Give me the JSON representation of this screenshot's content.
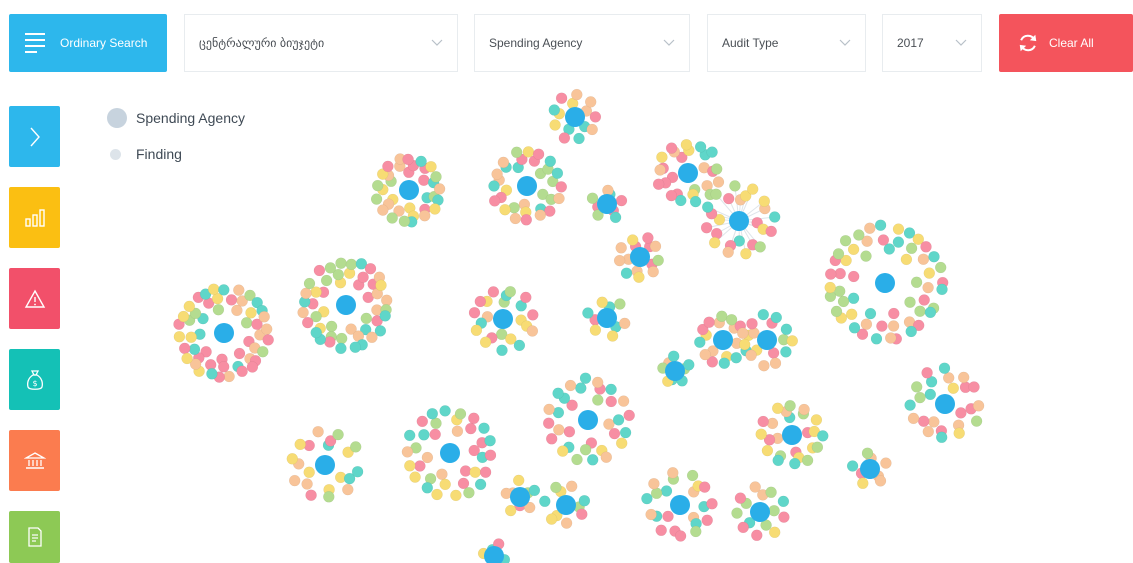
{
  "toolbar": {
    "search_label": "Ordinary Search",
    "filters": [
      {
        "name": "organization-select",
        "value": "ცენტრალური ბიუჯეტი"
      },
      {
        "name": "spending-agency-select",
        "value": "Spending Agency"
      },
      {
        "name": "audit-type-select",
        "value": "Audit Type"
      },
      {
        "name": "year-select",
        "value": "2017"
      }
    ],
    "clear_label": "Clear All"
  },
  "sidebar": {
    "items": [
      {
        "name": "expand-sidebar-button",
        "icon": "chevron-right-icon",
        "color": "#2db7ec"
      },
      {
        "name": "statistics-button",
        "icon": "bar-chart-icon",
        "color": "#fbbf12"
      },
      {
        "name": "warnings-button",
        "icon": "warning-icon",
        "color": "#f2506a"
      },
      {
        "name": "budget-button",
        "icon": "money-bag-icon",
        "color": "#14c1b6"
      },
      {
        "name": "institutions-button",
        "icon": "bank-icon",
        "color": "#fb7c4f"
      },
      {
        "name": "reports-button",
        "icon": "document-icon",
        "color": "#8dc955"
      }
    ]
  },
  "legend": {
    "agency_label": "Spending Agency",
    "finding_label": "Finding"
  },
  "colors": {
    "agency": "#2aaee8",
    "legend_agency": "#c7d3de",
    "legend_finding": "#dde4ea",
    "findings": [
      "#f78ea3",
      "#f8c499",
      "#f7dc74",
      "#5fd6c9",
      "#b4dc90"
    ]
  }
}
